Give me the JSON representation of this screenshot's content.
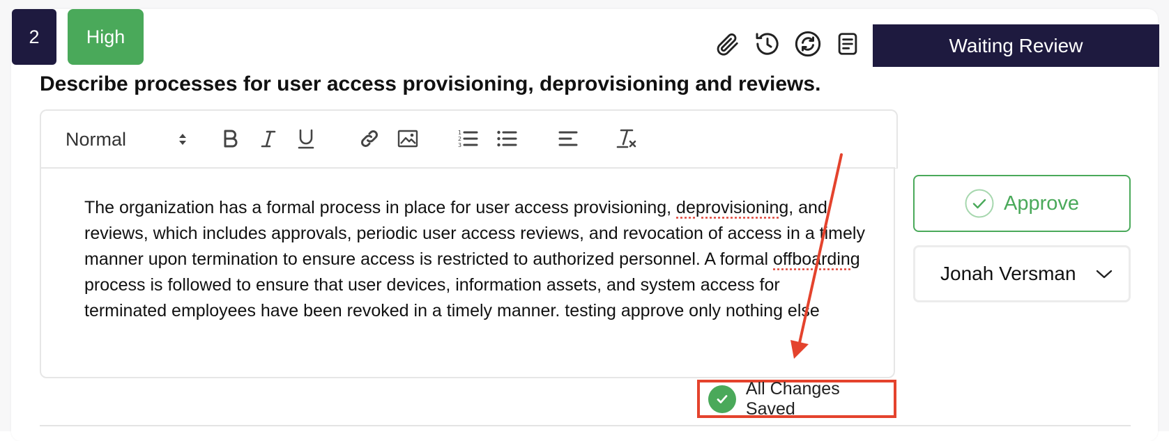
{
  "item": {
    "number": "2",
    "priority": "High",
    "status": "Waiting Review",
    "question": "Describe processes for user access provisioning, deprovisioning and reviews."
  },
  "toolbar": {
    "format_value": "Normal",
    "icons": [
      "bold-icon",
      "italic-icon",
      "underline-icon",
      "link-icon",
      "image-icon",
      "ordered-list-icon",
      "bullet-list-icon",
      "align-icon",
      "clear-format-icon"
    ]
  },
  "header_icons": [
    "paperclip-icon",
    "history-icon",
    "sync-icon",
    "document-icon"
  ],
  "editor": {
    "p1": "The organization has a formal process in place for user access provisioning, ",
    "w1": "deprovisioning",
    "p2": ", and reviews, which includes approvals, periodic user access reviews, and revocation of access in a timely manner upon termination to ensure access is restricted to authorized personnel. A formal ",
    "w2": "offboarding",
    "p3": " process is followed to ensure that user devices, information assets, and system access for terminated employees have been revoked in a timely manner. testing approve only nothing else"
  },
  "actions": {
    "approve_label": "Approve",
    "assignee": "Jonah Versman"
  },
  "save_status": "All Changes Saved",
  "colors": {
    "navy": "#1e1a3f",
    "green": "#4aa95a",
    "highlight_red": "#e4432d"
  }
}
